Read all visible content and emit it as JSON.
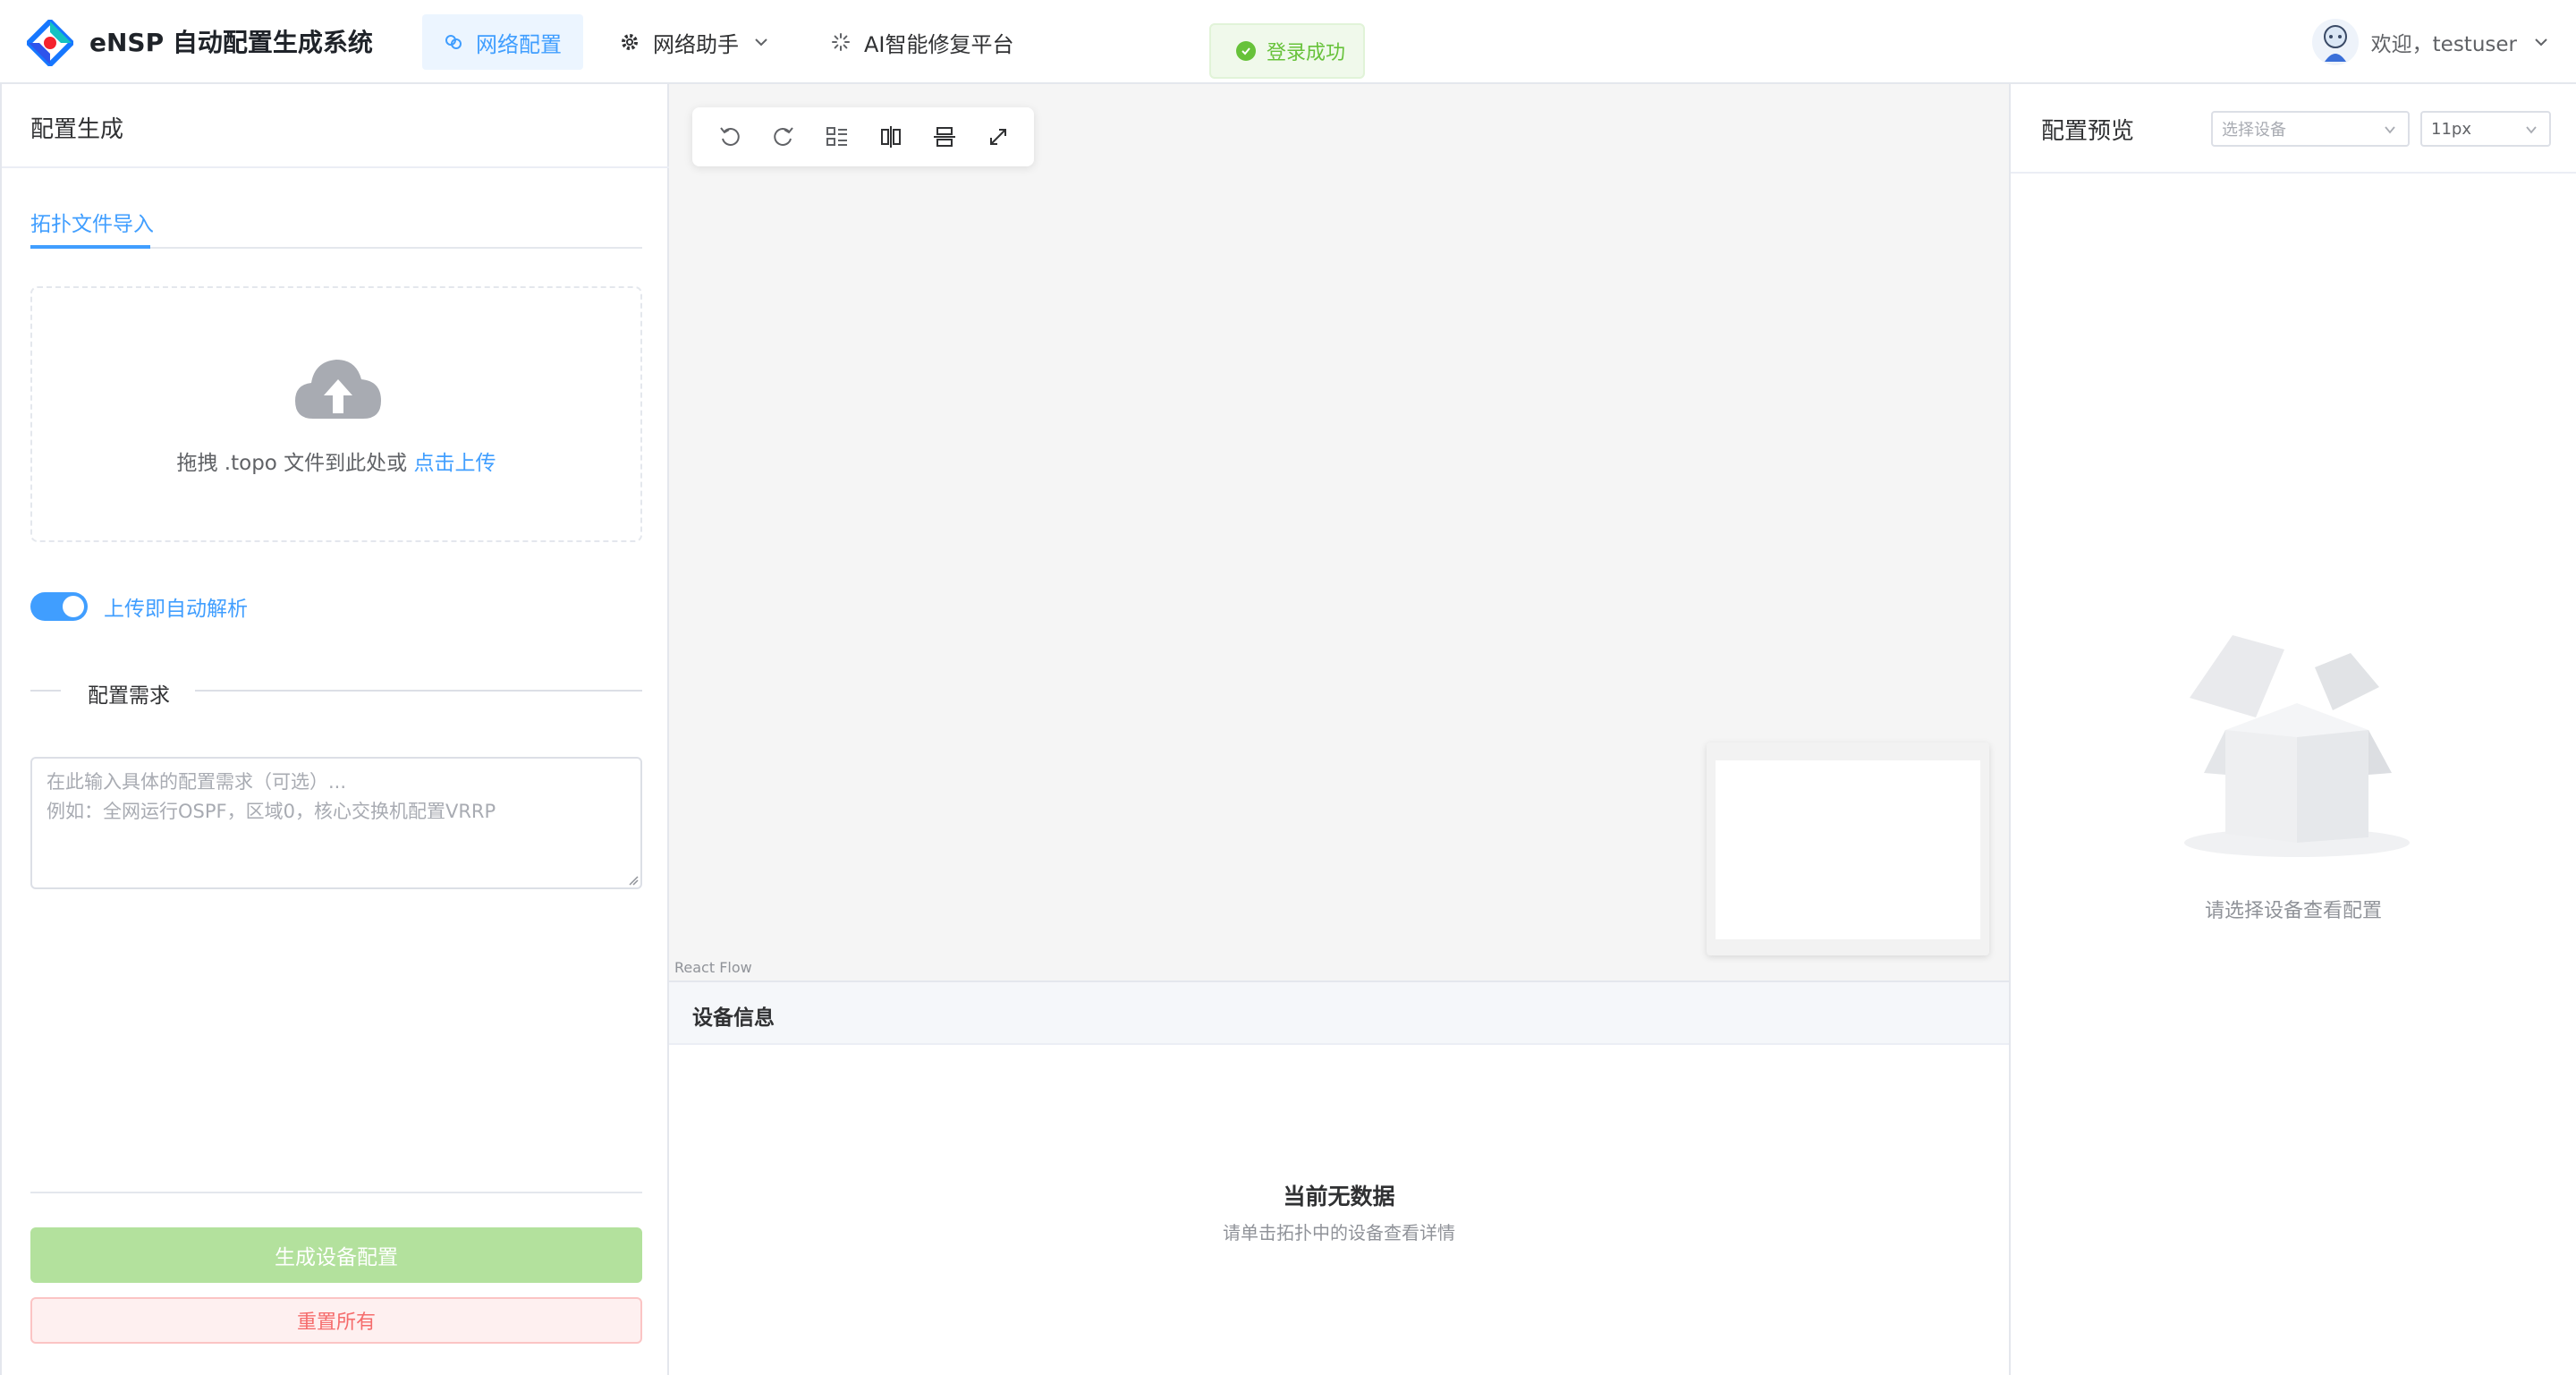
{
  "header": {
    "app_title": "eNSP 自动配置生成系统",
    "nav": {
      "config": "网络配置",
      "assistant": "网络助手",
      "ai": "AI智能修复平台"
    },
    "toast": "登录成功",
    "user": "欢迎，testuser"
  },
  "left": {
    "title": "配置生成",
    "tab": "拓扑文件导入",
    "upload_text": "拖拽 .topo 文件到此处或 ",
    "upload_link": "点击上传",
    "switch_label": "上传即自动解析",
    "auto_parse_on": true,
    "section_label": "配置需求",
    "requirement_placeholder_line1": "在此输入具体的配置需求（可选）...",
    "requirement_placeholder_line2": "例如：全网运行OSPF，区域0，核心交换机配置VRRP",
    "generate_button": "生成设备配置",
    "reset_button": "重置所有"
  },
  "canvas": {
    "attribution": "React Flow",
    "toolbar": [
      "undo-icon",
      "redo-icon",
      "layout-icon",
      "align-horizontal-icon",
      "align-vertical-icon",
      "fullscreen-icon"
    ]
  },
  "device_info": {
    "title": "设备信息",
    "empty_title": "当前无数据",
    "empty_subtitle": "请单击拓扑中的设备查看详情"
  },
  "preview": {
    "title": "配置预览",
    "device_select_placeholder": "选择设备",
    "font_size": "11px",
    "empty_text": "请选择设备查看配置"
  },
  "colors": {
    "primary": "#409eff",
    "success": "#67c23a",
    "danger": "#f56c6c",
    "disabled_success": "#b3e19d"
  }
}
